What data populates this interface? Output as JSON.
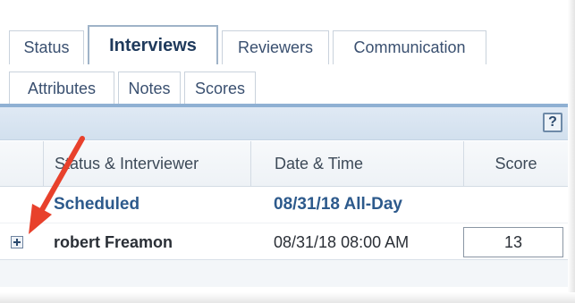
{
  "tabs": {
    "row1": [
      {
        "label": "Status",
        "active": false
      },
      {
        "label": "Interviews",
        "active": true
      },
      {
        "label": "Reviewers",
        "active": false
      },
      {
        "label": "Communication",
        "active": false
      }
    ],
    "row2": [
      {
        "label": "Attributes",
        "active": false
      },
      {
        "label": "Notes",
        "active": false
      },
      {
        "label": "Scores",
        "active": false
      }
    ]
  },
  "toolbar": {
    "help_label": "?",
    "help_icon": "help-icon"
  },
  "grid": {
    "columns": {
      "status_interviewer": "Status & Interviewer",
      "date_time": "Date & Time",
      "score": "Score"
    },
    "group": {
      "status": "Scheduled",
      "date": "08/31/18 All-Day"
    },
    "rows": [
      {
        "interviewer": "robert Freamon",
        "date_time": "08/31/18 08:00 AM",
        "score": "13",
        "expand_icon": "plus-box-icon"
      }
    ]
  },
  "colors": {
    "accent": "#8fb0d3",
    "group_text": "#2d5a8c",
    "annotation_arrow": "#e8412c"
  }
}
